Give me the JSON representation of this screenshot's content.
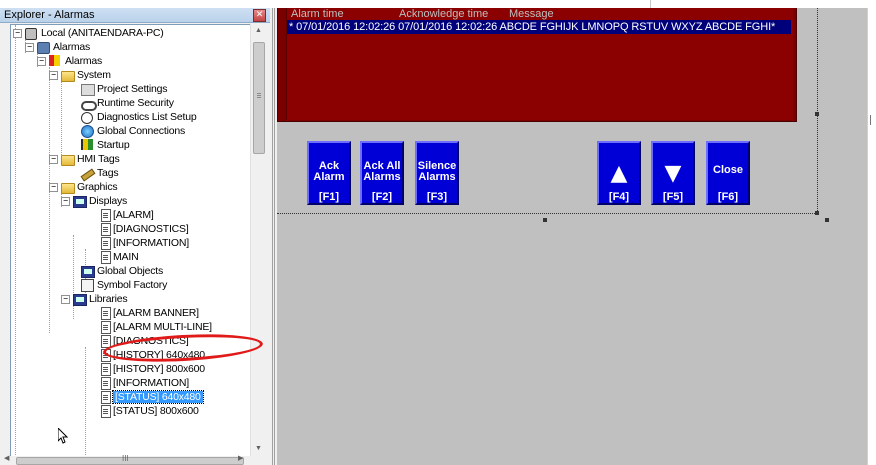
{
  "explorer": {
    "title": "Explorer - Alarmas",
    "close_glyph": "✕",
    "tree": [
      {
        "label": "Local (ANITAENDARA-PC)",
        "icon": "computer-icon"
      },
      {
        "label": "Alarmas",
        "icon": "application-icon"
      },
      {
        "label": "Alarmas",
        "icon": "alarms-icon"
      },
      {
        "label": "System",
        "icon": "folder-icon"
      },
      {
        "label": "Project Settings",
        "icon": "project-settings-icon"
      },
      {
        "label": "Runtime Security",
        "icon": "key-icon"
      },
      {
        "label": "Diagnostics List Setup",
        "icon": "diagnostics-icon"
      },
      {
        "label": "Global Connections",
        "icon": "globe-icon"
      },
      {
        "label": "Startup",
        "icon": "startup-flag-icon"
      },
      {
        "label": "HMI Tags",
        "icon": "folder-icon"
      },
      {
        "label": "Tags",
        "icon": "tag-pen-icon"
      },
      {
        "label": "Graphics",
        "icon": "folder-icon"
      },
      {
        "label": "Displays",
        "icon": "display-icon"
      },
      {
        "label": "[ALARM]",
        "icon": "document-icon"
      },
      {
        "label": "[DIAGNOSTICS]",
        "icon": "document-icon"
      },
      {
        "label": "[INFORMATION]",
        "icon": "document-icon"
      },
      {
        "label": "MAIN",
        "icon": "document-icon"
      },
      {
        "label": "Global Objects",
        "icon": "display-icon"
      },
      {
        "label": "Symbol Factory",
        "icon": "symbol-factory-icon"
      },
      {
        "label": "Libraries",
        "icon": "display-icon"
      },
      {
        "label": "[ALARM BANNER]",
        "icon": "document-icon"
      },
      {
        "label": "[ALARM MULTI-LINE]",
        "icon": "document-icon"
      },
      {
        "label": "[DIAGNOSTICS]",
        "icon": "document-icon"
      },
      {
        "label": "[HISTORY] 640x480",
        "icon": "document-icon"
      },
      {
        "label": "[HISTORY] 800x600",
        "icon": "document-icon"
      },
      {
        "label": "[INFORMATION]",
        "icon": "document-icon"
      },
      {
        "label": "[STATUS] 640x480",
        "icon": "document-icon",
        "selected": true
      },
      {
        "label": "[STATUS] 800x600",
        "icon": "document-icon"
      }
    ],
    "hscroll_grip": "III"
  },
  "alarm_banner": {
    "headers": {
      "time": "Alarm time",
      "ack": "Acknowledge time",
      "message": "Message"
    },
    "row": "* 07/01/2016 12:02:26  07/01/2016 12:02:26  ABCDE FGHIJK LMNOPQ RSTUV WXYZ ABCDE FGHI*",
    "colors": {
      "panel": "#8b0000",
      "row_bg": "#00007a",
      "header_text": "#bfbfbf"
    }
  },
  "buttons": [
    {
      "id": "ack-alarm",
      "label": "Ack\nAlarm",
      "key": "[F1]"
    },
    {
      "id": "ack-all-alarms",
      "label": "Ack All\nAlarms",
      "key": "[F2]"
    },
    {
      "id": "silence-alarms",
      "label": "Silence\nAlarms",
      "key": "[F3]"
    },
    {
      "id": "move-up",
      "glyph": "▲",
      "icon": "arrow-up-icon",
      "key": "[F4]"
    },
    {
      "id": "move-down",
      "glyph": "▼",
      "icon": "arrow-down-icon",
      "key": "[F5]"
    },
    {
      "id": "close",
      "label": "Close",
      "key": "[F6]"
    }
  ],
  "theme": {
    "button_blue": "#0000d6",
    "canvas": "#c0c0c0",
    "annotation": "#e01919",
    "selection": "#3399ff"
  }
}
